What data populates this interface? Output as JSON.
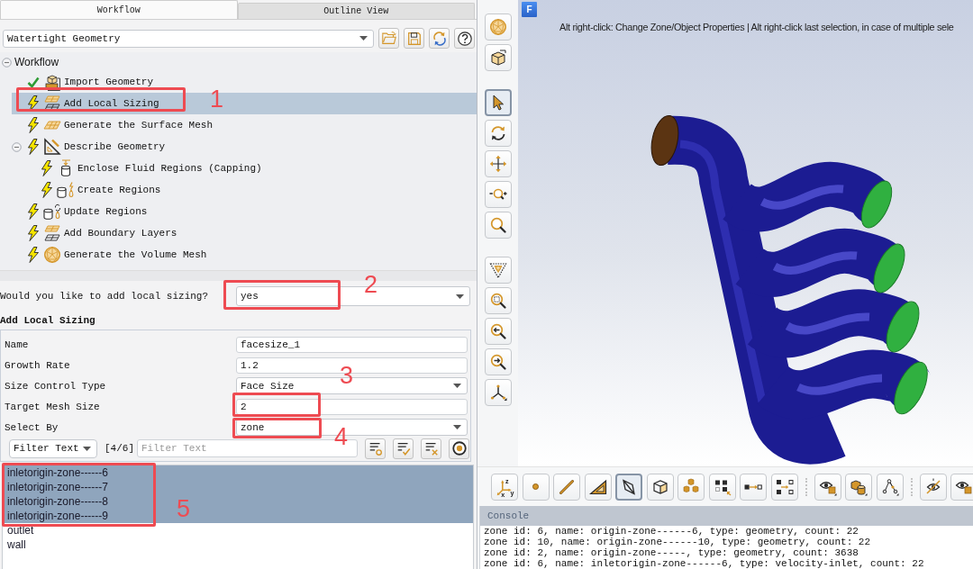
{
  "tabs": [
    {
      "label": "Workflow",
      "selected": true
    },
    {
      "label": "Outline View",
      "selected": false
    }
  ],
  "workflow_type": {
    "value": "Watertight Geometry"
  },
  "workflow_tree": {
    "label": "Workflow",
    "selected": false,
    "expanded": true,
    "children": [
      {
        "label": "Import Geometry",
        "kind": "import",
        "completed": true,
        "selected": false
      },
      {
        "label": "Add Local Sizing",
        "kind": "sizing",
        "completed": false,
        "selected": true
      },
      {
        "label": "Generate the Surface Mesh",
        "kind": "surface-mesh",
        "completed": false,
        "selected": false
      },
      {
        "label": "Describe Geometry",
        "kind": "describe",
        "completed": false,
        "selected": false,
        "expanded": true,
        "children": [
          {
            "label": "Enclose Fluid Regions (Capping)",
            "kind": "capping",
            "completed": false,
            "selected": false
          },
          {
            "label": "Create Regions",
            "kind": "regions",
            "completed": false,
            "selected": false
          }
        ]
      },
      {
        "label": "Update Regions",
        "kind": "update-regions",
        "completed": false,
        "selected": false
      },
      {
        "label": "Add Boundary Layers",
        "kind": "boundary-layers",
        "completed": false,
        "selected": false
      },
      {
        "label": "Generate the Volume Mesh",
        "kind": "volume-mesh",
        "completed": false,
        "selected": false
      }
    ]
  },
  "question": {
    "label": "Would you like to add local sizing?",
    "value": "yes"
  },
  "section_title": "Add Local Sizing",
  "fields": [
    {
      "label": "Name",
      "kind": "text",
      "value": "facesize_1"
    },
    {
      "label": "Growth Rate",
      "kind": "text",
      "value": "1.2"
    },
    {
      "label": "Size Control Type",
      "kind": "dropdown",
      "value": "Face Size"
    },
    {
      "label": "Target Mesh Size",
      "kind": "text",
      "value": "2"
    },
    {
      "label": "Select By",
      "kind": "dropdown",
      "value": "zone"
    }
  ],
  "filter": {
    "mode": "Filter Text",
    "count": "[4/6]",
    "placeholder": "Filter Text"
  },
  "zones": [
    {
      "label": "inletorigin-zone------6",
      "selected": true
    },
    {
      "label": "inletorigin-zone------7",
      "selected": true
    },
    {
      "label": "inletorigin-zone------8",
      "selected": true
    },
    {
      "label": "inletorigin-zone------9",
      "selected": true
    },
    {
      "label": "outlet",
      "selected": false
    },
    {
      "label": "wall",
      "selected": false
    }
  ],
  "annotations": [
    {
      "label": "1"
    },
    {
      "label": "2"
    },
    {
      "label": "3"
    },
    {
      "label": "4"
    },
    {
      "label": "5"
    }
  ],
  "viewport": {
    "logo": "F",
    "hint": "Alt right-click: Change Zone/Object Properties | Alt right-click last selection, in case of multiple sele"
  },
  "view_tools": [
    {
      "tools": [
        {
          "kind": "mesh-display",
          "selected": false
        },
        {
          "kind": "bounding-box",
          "selected": false
        }
      ]
    },
    {
      "tools": [
        {
          "kind": "select",
          "selected": true
        },
        {
          "kind": "rotate",
          "selected": false
        },
        {
          "kind": "pan",
          "selected": false
        },
        {
          "kind": "zoom-drag",
          "selected": false
        },
        {
          "kind": "zoom",
          "selected": false
        }
      ]
    },
    {
      "tools": [
        {
          "kind": "view-filter",
          "selected": false
        },
        {
          "kind": "zoom-box",
          "selected": false
        },
        {
          "kind": "zoom-previous",
          "selected": false
        },
        {
          "kind": "zoom-next",
          "selected": false
        },
        {
          "kind": "axes",
          "selected": false
        }
      ]
    }
  ],
  "selection_tools": [
    {
      "tools": [
        {
          "kind": "axes-xyz",
          "labels": [
            "z",
            "x",
            "y"
          ],
          "selected": false
        },
        {
          "kind": "point",
          "selected": false
        },
        {
          "kind": "edge",
          "selected": false
        },
        {
          "kind": "triangle",
          "selected": false
        },
        {
          "kind": "face",
          "selected": true
        },
        {
          "kind": "cell",
          "selected": false
        },
        {
          "kind": "cells",
          "selected": false
        },
        {
          "kind": "zone-grid",
          "selected": false
        },
        {
          "kind": "object-arrow",
          "selected": false
        },
        {
          "kind": "object-grid",
          "selected": false
        }
      ]
    },
    {
      "tools": [
        {
          "kind": "eye-box",
          "selected": false
        },
        {
          "kind": "cube-cylinder",
          "selected": false
        },
        {
          "kind": "node-path",
          "selected": false
        }
      ]
    },
    {
      "tools": [
        {
          "kind": "hide",
          "selected": false
        },
        {
          "kind": "show",
          "selected": false
        }
      ]
    }
  ],
  "console": {
    "title": "Console",
    "lines": [
      "zone id: 6, name: origin-zone------6, type: geometry, count: 22",
      "zone id: 10, name: origin-zone------10, type: geometry, count: 22",
      "zone id: 2, name: origin-zone-----, type: geometry, count: 3638",
      "zone id: 6, name: inletorigin-zone------6, type: velocity-inlet, count: 22"
    ]
  }
}
